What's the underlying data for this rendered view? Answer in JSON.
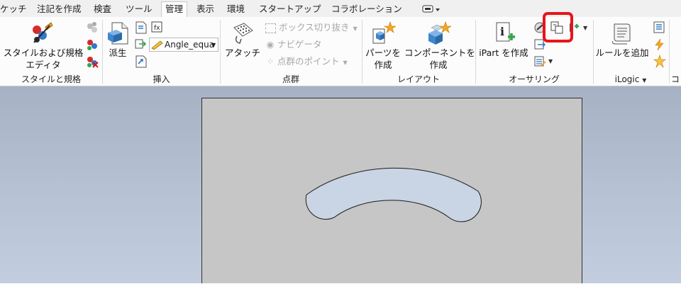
{
  "tabs": [
    "ケッチ",
    "注記を作成",
    "検査",
    "ツール",
    "管理",
    "表示",
    "環境",
    "スタートアップ",
    "コラボレーション"
  ],
  "active_tab": "管理",
  "panels": {
    "style": {
      "button_line1": "スタイルおよび規格",
      "button_line2": "エディタ",
      "label": "スタイルと規格"
    },
    "insert": {
      "derive_label": "派生",
      "param_dropdown_value": "Angle_equa",
      "label": "挿入"
    },
    "pointcloud": {
      "attach_label": "アタッチ",
      "box_crop_label": "ボックス切り抜き",
      "navigator_label": "ナビゲータ",
      "points_label": "点群のポイント",
      "label": "点群"
    },
    "layout": {
      "part_line1": "パーツを",
      "part_line2": "作成",
      "component_line1": "コンポーネントを",
      "component_line2": "作成",
      "label": "レイアウト"
    },
    "authoring": {
      "ipart_label": "iPart を作成",
      "label": "オーサリング"
    },
    "ilogic": {
      "add_rule_label": "ルールを追加",
      "label": "iLogic",
      "label_arrow": "▼"
    }
  },
  "colors": {
    "highlight": "#e8141c",
    "tab_bg": "#f0f0f0",
    "ribbon_bg": "#fcfcfc",
    "sheet_bg": "#c6c6c6",
    "shape_fill": "#c9d4e4",
    "accent_orange": "#f5a623",
    "accent_green": "#2ea84a",
    "accent_blue": "#2f7ac8"
  }
}
